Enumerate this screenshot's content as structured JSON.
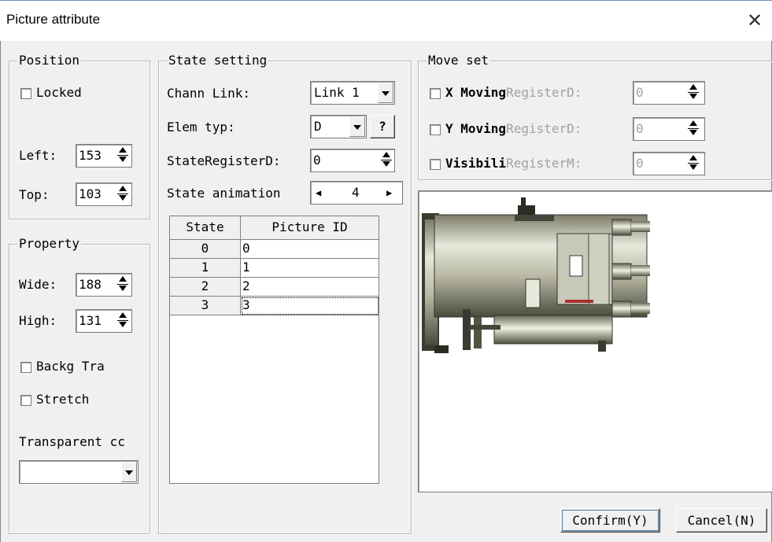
{
  "window": {
    "title": "Picture attribute"
  },
  "position": {
    "legend": "Position",
    "locked_label": "Locked",
    "left_label": "Left:",
    "left_value": "153",
    "top_label": "Top:",
    "top_value": "103"
  },
  "property": {
    "legend": "Property",
    "wide_label": "Wide:",
    "wide_value": "188",
    "high_label": "High:",
    "high_value": "131",
    "backg_label": "Backg Tra",
    "stretch_label": "Stretch",
    "transparent_label": "Transparent cc",
    "transparent_value": ""
  },
  "state_setting": {
    "legend": "State setting",
    "chann_label": "Chann Link:",
    "chann_value": "Link 1",
    "elem_label": "Elem typ:",
    "elem_value": "D",
    "elem_help": "?",
    "state_reg_label": "StateRegisterD:",
    "state_reg_value": "0",
    "anim_label": "State animation",
    "anim_value": "4",
    "table": {
      "headers": [
        "State",
        "Picture ID"
      ],
      "rows": [
        {
          "state": "0",
          "picture_id": "0"
        },
        {
          "state": "1",
          "picture_id": "1"
        },
        {
          "state": "2",
          "picture_id": "2"
        },
        {
          "state": "3",
          "picture_id": "3"
        }
      ]
    }
  },
  "move_set": {
    "legend": "Move set",
    "rows": [
      {
        "name": "X Moving",
        "reg": "RegisterD:",
        "value": "0"
      },
      {
        "name": "Y Moving",
        "reg": "RegisterD:",
        "value": "0"
      },
      {
        "name": "Visibili",
        "reg": "RegisterM:",
        "value": "0"
      }
    ]
  },
  "buttons": {
    "confirm": "Confirm(Y)",
    "cancel": "Cancel(N)"
  },
  "icons": {
    "close": "close-icon",
    "spinner": "spin-updown-icon",
    "dropdown": "chevron-down-icon"
  }
}
